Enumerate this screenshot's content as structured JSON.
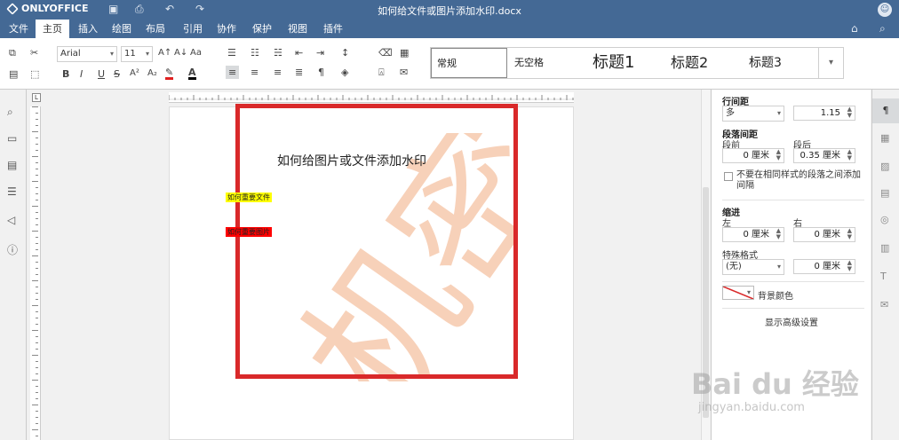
{
  "app": {
    "logo_text": "ONLYOFFICE",
    "doc_title": "如何给文件或图片添加水印.docx"
  },
  "menu": {
    "tabs": [
      {
        "label": "文件"
      },
      {
        "label": "主页"
      },
      {
        "label": "插入"
      },
      {
        "label": "绘图"
      },
      {
        "label": "布局"
      },
      {
        "label": "引用"
      },
      {
        "label": "协作"
      },
      {
        "label": "保护"
      },
      {
        "label": "视图"
      },
      {
        "label": "插件"
      }
    ],
    "active_tab": "主页"
  },
  "toolbar": {
    "font_name": "Arial",
    "font_size": "11",
    "bold": "B",
    "italic": "I",
    "underline": "U",
    "strike": "S",
    "superscript": "A²",
    "subscript": "A₂",
    "grow_font": "A↑",
    "shrink_font": "A↓",
    "change_case": "Aa",
    "styles": [
      {
        "label": "常规"
      },
      {
        "label": "无空格"
      },
      {
        "label": "标题1"
      },
      {
        "label": "标题2"
      },
      {
        "label": "标题3"
      }
    ]
  },
  "document": {
    "heading": "如何给图片或文件添加水印",
    "highlight_yellow": "如何重要文件",
    "highlight_red": "如何重要图片",
    "watermark_text": "机密",
    "watermark_color": "#f6c9ad",
    "frame_color": "#d9292a"
  },
  "right_panel": {
    "line_spacing_title": "行间距",
    "line_spacing_mode": "多",
    "line_spacing_value": "1.15",
    "para_spacing_title": "段落间距",
    "before_label": "段前",
    "after_label": "段后",
    "before_value": "0 厘米",
    "after_value": "0.35 厘米",
    "no_space_same_style": "不要在相同样式的段落之间添加间隔",
    "indent_title": "缩进",
    "left_label": "左",
    "right_label": "右",
    "left_value": "0 厘米",
    "right_value": "0 厘米",
    "special_label": "特殊格式",
    "special_value": "(无)",
    "special_amount": "0 厘米",
    "background_color_label": "背景颜色",
    "advanced_settings": "显示高级设置"
  },
  "colors": {
    "header": "#446995",
    "accent": "#d9292a"
  },
  "overlay": {
    "baidu_logo": "Bai du 经验",
    "baidu_url": "jingyan.baidu.com"
  }
}
